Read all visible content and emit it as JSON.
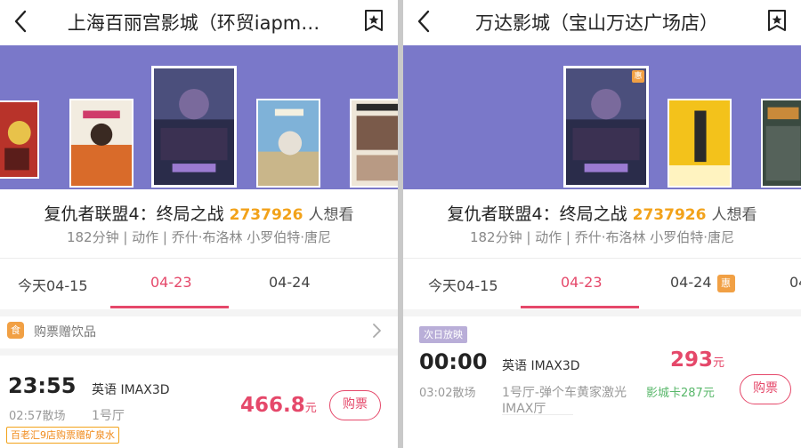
{
  "left": {
    "title": "上海百丽宫影城（环贸iapm…",
    "movie": {
      "title": "复仇者联盟4：终局之战",
      "want_count": "2737926",
      "want_label": "人想看",
      "meta": "182分钟 | 动作 | 乔什·布洛林 小罗伯特·唐尼"
    },
    "tabs": [
      {
        "label": "今天04-15"
      },
      {
        "label": "04-23"
      },
      {
        "label": "04-24"
      }
    ],
    "drinks": {
      "icon_char": "食",
      "text": "购票赠饮品"
    },
    "showtime": {
      "start": "23:55",
      "end": "02:57散场",
      "lang": "英语 IMAX3D",
      "hall": "1号厅",
      "price": "466.8",
      "price_unit": "元",
      "buy_label": "购票",
      "gift": "百老汇9店购票赠矿泉水"
    }
  },
  "right": {
    "title": "万达影城（宝山万达广场店）",
    "movie": {
      "title": "复仇者联盟4：终局之战",
      "want_count": "2737926",
      "want_label": "人想看",
      "meta": "182分钟 | 动作 | 乔什·布洛林 小罗伯特·唐尼"
    },
    "tabs": [
      {
        "label": "今天04-15"
      },
      {
        "label": "04-23"
      },
      {
        "label": "04-24"
      },
      {
        "label": "04"
      }
    ],
    "hui": "惠",
    "next_day": "次日放映",
    "showtime": {
      "start": "00:00",
      "end": "03:02散场",
      "lang": "英语 IMAX3D",
      "hall_line1": "1号厅-弹个车黄家激光",
      "hall_line2": "IMAX厅",
      "price": "293",
      "price_unit": "元",
      "card_price": "影城卡287元",
      "buy_label": "购票"
    }
  },
  "icons": {
    "back": "chevron-left-icon",
    "favorite": "bookmark-star-icon",
    "chevron": "chevron-right-icon"
  },
  "colors": {
    "accent": "#e5486a",
    "orange": "#f2a21a",
    "carousel_bg": "#7a78c9",
    "card_green": "#58b76a"
  }
}
